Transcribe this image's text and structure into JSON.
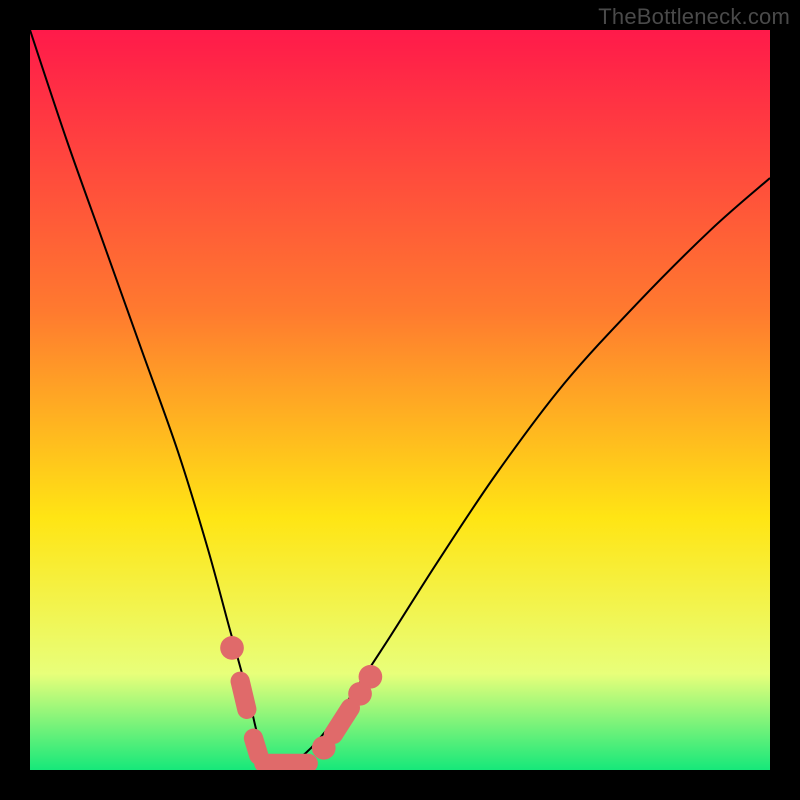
{
  "watermark": "TheBottleneck.com",
  "colors": {
    "frame": "#000000",
    "watermark_text": "#4a4a4a",
    "gradient_top": "#ff1a4a",
    "gradient_mid1": "#ff7a2f",
    "gradient_mid2": "#ffe514",
    "gradient_low": "#e8ff7a",
    "gradient_bottom": "#16e87a",
    "curve": "#000000",
    "marker_fill": "#e06a6a",
    "marker_stroke": "#c14f4f"
  },
  "chart_data": {
    "type": "line",
    "title": "",
    "xlabel": "",
    "ylabel": "",
    "xlim": [
      0,
      100
    ],
    "ylim": [
      0,
      100
    ],
    "grid": false,
    "legend": false,
    "note": "V-shaped bottleneck curve; background is a vertical heat gradient (red→green). Curve minimum marked with salmon capsule markers near the bottom. Axes have no visible tick labels or numeric scale.",
    "series": [
      {
        "name": "bottleneck-curve",
        "x": [
          0,
          5,
          10,
          15,
          20,
          24,
          27,
          29.5,
          31,
          33,
          35,
          38,
          42,
          48,
          55,
          63,
          72,
          82,
          92,
          100
        ],
        "y": [
          100,
          85,
          71,
          57,
          43,
          30,
          19,
          10,
          4,
          0.8,
          0.8,
          3,
          8,
          17,
          28,
          40,
          52,
          63,
          73,
          80
        ]
      }
    ],
    "markers": [
      {
        "kind": "dot",
        "x": 27.3,
        "y": 16.5,
        "r": 1.6
      },
      {
        "kind": "capsule",
        "x1": 28.4,
        "y1": 12.0,
        "x2": 29.3,
        "y2": 8.2,
        "w": 2.6
      },
      {
        "kind": "capsule",
        "x1": 30.2,
        "y1": 4.3,
        "x2": 30.9,
        "y2": 2.0,
        "w": 2.6
      },
      {
        "kind": "capsule",
        "x1": 31.6,
        "y1": 0.9,
        "x2": 37.6,
        "y2": 0.9,
        "w": 2.6
      },
      {
        "kind": "dot",
        "x": 39.7,
        "y": 3.0,
        "r": 1.6
      },
      {
        "kind": "capsule",
        "x1": 41.0,
        "y1": 4.8,
        "x2": 43.3,
        "y2": 8.4,
        "w": 2.6
      },
      {
        "kind": "dot",
        "x": 44.6,
        "y": 10.3,
        "r": 1.6
      },
      {
        "kind": "dot",
        "x": 46.0,
        "y": 12.6,
        "r": 1.6
      }
    ]
  }
}
